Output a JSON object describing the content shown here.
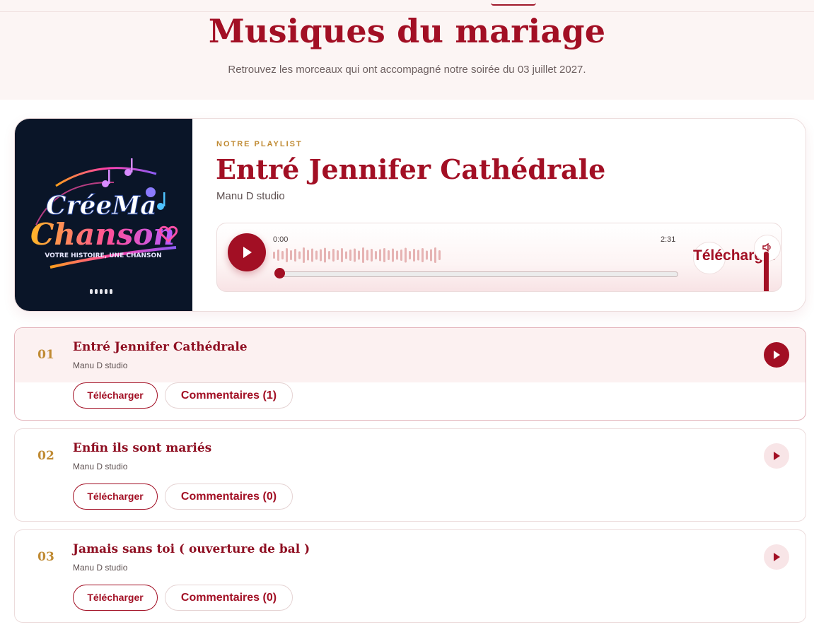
{
  "hero": {
    "title": "Musiques du mariage",
    "subtitle": "Retrouvez les morceaux qui ont accompagné notre soirée du 03 juillet 2027."
  },
  "player": {
    "kicker": "NOTRE PLAYLIST",
    "title": "Entré Jennifer Cathédrale",
    "artist": "Manu D studio",
    "current_time": "0:00",
    "duration": "2:31",
    "progress": 0,
    "download_label": "Télécharger",
    "cover": {
      "logo_line1": "CréeMa",
      "logo_line2": "Chanson",
      "tagline": "VOTRE HISTOIRE, UNE CHANSON"
    }
  },
  "tracks": [
    {
      "number": "01",
      "title": "Entré Jennifer Cathédrale",
      "artist": "Manu D studio",
      "download_label": "Télécharger",
      "comments_label": "Commentaires (1)",
      "active": true
    },
    {
      "number": "02",
      "title": "Enfin ils sont mariés",
      "artist": "Manu D studio",
      "download_label": "Télécharger",
      "comments_label": "Commentaires (0)",
      "active": false
    },
    {
      "number": "03",
      "title": "Jamais sans toi ( ouverture de bal )",
      "artist": "Manu D studio",
      "download_label": "Télécharger",
      "comments_label": "Commentaires (0)",
      "active": false
    }
  ],
  "colors": {
    "accent": "#a20f24",
    "gold": "#c08b34",
    "hero_bg": "#fcf5f4"
  },
  "icons": [
    "play-icon",
    "volume-icon",
    "music-note-icon"
  ]
}
